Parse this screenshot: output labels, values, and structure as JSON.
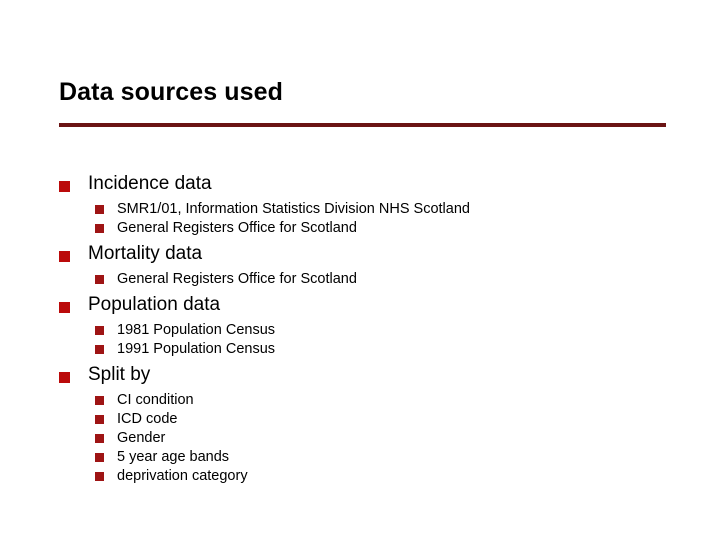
{
  "slide": {
    "title": "Data sources used",
    "accent_rule_color": "#6b1414",
    "background_color": "#ffffff",
    "bullet_level1_color": "#bb0a0a",
    "bullet_level2_color": "#9e1414",
    "text_color": "#000000",
    "bullet_icon": "filled-square-bullet",
    "groups": [
      {
        "heading": "Incidence data",
        "items": [
          "SMR1/01, Information Statistics Division NHS Scotland",
          "General Registers Office for Scotland"
        ]
      },
      {
        "heading": "Mortality data",
        "items": [
          "General Registers Office for Scotland"
        ]
      },
      {
        "heading": "Population data",
        "items": [
          "1981 Population Census",
          "1991 Population Census"
        ]
      },
      {
        "heading": "Split by",
        "items": [
          "CI condition",
          "ICD code",
          "Gender",
          " 5 year age bands",
          " deprivation category"
        ]
      }
    ]
  }
}
